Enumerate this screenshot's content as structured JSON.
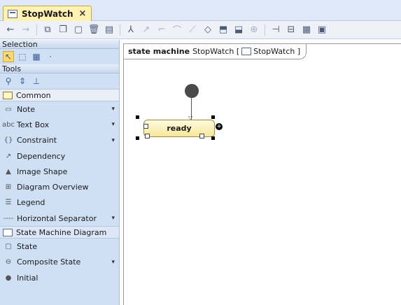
{
  "tab": {
    "title": "StopWatch",
    "close": "×"
  },
  "toolbar": {
    "icons": [
      "back-arrow",
      "forward-arrow",
      "diagram-nav",
      "copy",
      "new-diagram",
      "delete",
      "print",
      "layout",
      "path-tools",
      "fill",
      "format",
      "align",
      "zoom"
    ]
  },
  "palette": {
    "selection_header": "Selection",
    "selection_more": "·",
    "tools_header": "Tools",
    "common_group": "Common",
    "common_items": [
      {
        "label": "Note",
        "icon": "note-icon",
        "has_arrow": true
      },
      {
        "label": "Text Box",
        "icon": "text-box-icon",
        "prefix": "abc",
        "has_arrow": true
      },
      {
        "label": "Constraint",
        "icon": "constraint-icon",
        "prefix": "{}",
        "has_arrow": true
      },
      {
        "label": "Dependency",
        "icon": "dependency-icon",
        "has_arrow": false
      },
      {
        "label": "Image Shape",
        "icon": "image-shape-icon",
        "has_arrow": false
      },
      {
        "label": "Diagram Overview",
        "icon": "diagram-overview-icon",
        "has_arrow": false
      },
      {
        "label": "Legend",
        "icon": "legend-icon",
        "has_arrow": false
      },
      {
        "label": "Horizontal Separator",
        "icon": "horizontal-separator-icon",
        "prefix": "----",
        "has_arrow": true
      }
    ],
    "sm_group": "State Machine Diagram",
    "sm_items": [
      {
        "label": "State",
        "icon": "state-icon",
        "has_arrow": false
      },
      {
        "label": "Composite State",
        "icon": "composite-state-icon",
        "has_arrow": true
      },
      {
        "label": "Initial",
        "icon": "initial-icon",
        "has_arrow": false
      }
    ],
    "arrow_glyph": "▾"
  },
  "diagram": {
    "frame_keyword": "state machine",
    "frame_name": "StopWatch",
    "frame_ref": "StopWatch",
    "state_label": "ready",
    "plus_glyph": "+"
  }
}
